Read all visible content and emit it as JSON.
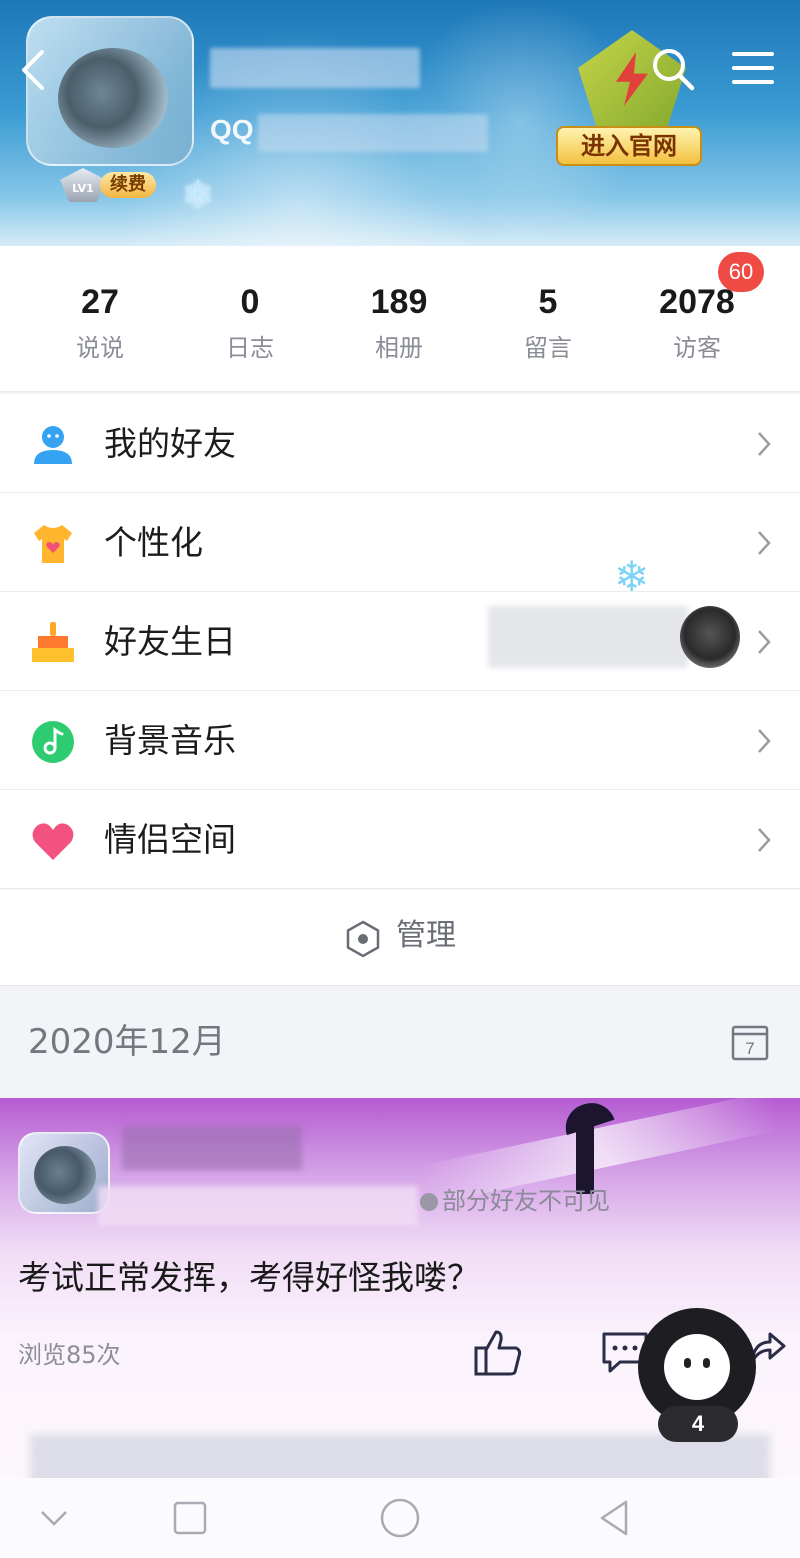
{
  "header": {
    "qq_label": "QQ",
    "level": "LV1",
    "renew_label": "续费",
    "official_site_label": "进入官网"
  },
  "stats": [
    {
      "value": "27",
      "label": "说说"
    },
    {
      "value": "0",
      "label": "日志"
    },
    {
      "value": "189",
      "label": "相册"
    },
    {
      "value": "5",
      "label": "留言"
    },
    {
      "value": "2078",
      "label": "访客"
    }
  ],
  "visitor_badge": "60",
  "menu": [
    {
      "label": "我的好友",
      "icon": "friends-icon"
    },
    {
      "label": "个性化",
      "icon": "tshirt-icon"
    },
    {
      "label": "好友生日",
      "icon": "cake-icon"
    },
    {
      "label": "背景音乐",
      "icon": "music-icon"
    },
    {
      "label": "情侣空间",
      "icon": "heart-icon"
    }
  ],
  "manage_label": "管理",
  "month_label": "2020年12月",
  "calendar_day": "7",
  "feed": {
    "privacy_label": "部分好友不可见",
    "post_text": "考试正常发挥，考得好怪我喽？",
    "views_label": "浏览85次"
  },
  "floating_count": "4",
  "colors": {
    "accent_red": "#f04a45",
    "gold": "#f2c13f",
    "text_primary": "#1c1c1c",
    "text_secondary": "#8a8d96"
  }
}
